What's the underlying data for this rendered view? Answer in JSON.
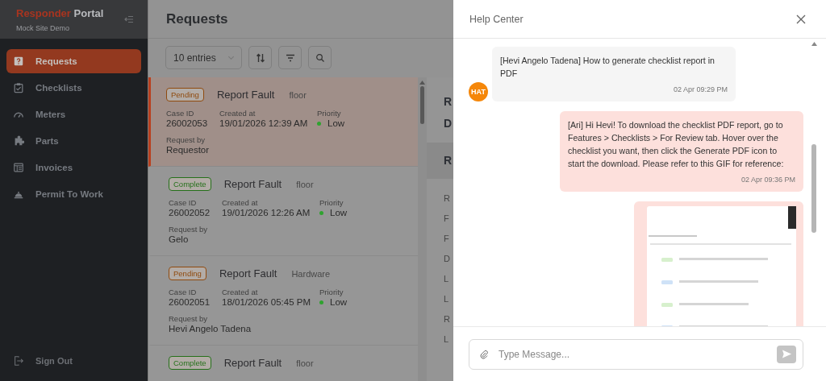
{
  "sidebar": {
    "brand_first": "Responder",
    "brand_second": "Portal",
    "subtitle": "Mock Site Demo",
    "items": [
      {
        "label": "Requests",
        "selected": true
      },
      {
        "label": "Checklists",
        "selected": false
      },
      {
        "label": "Meters",
        "selected": false
      },
      {
        "label": "Parts",
        "selected": false
      },
      {
        "label": "Invoices",
        "selected": false
      },
      {
        "label": "Permit To Work",
        "selected": false
      }
    ],
    "sign_out": "Sign Out"
  },
  "page": {
    "title": "Requests",
    "entries_select": "10 entries"
  },
  "requests": [
    {
      "status": {
        "text": "Pending",
        "color": "#8f4a0e"
      },
      "title": "Report Fault",
      "category": "floor",
      "case_id_label": "Case ID",
      "case_id": "26002053",
      "created_label": "Created at",
      "created": "19/01/2026 12:39 AM",
      "priority_label": "Priority",
      "priority": {
        "text": "Low",
        "color": "#2fa32f"
      },
      "requested_by_label": "Request by",
      "requested_by": "Requestor",
      "selected": true
    },
    {
      "status": {
        "text": "Complete",
        "color": "#25701a"
      },
      "title": "Report Fault",
      "category": "floor",
      "case_id_label": "Case ID",
      "case_id": "26002052",
      "created_label": "Created at",
      "created": "19/01/2026 12:26 AM",
      "priority_label": "Priority",
      "priority": {
        "text": "Low",
        "color": "#2fa32f"
      },
      "requested_by_label": "Request by",
      "requested_by": "Gelo",
      "selected": false
    },
    {
      "status": {
        "text": "Pending",
        "color": "#8f4a0e"
      },
      "title": "Report Fault",
      "category": "Hardware",
      "case_id_label": "Case ID",
      "case_id": "26002051",
      "created_label": "Created at",
      "created": "18/01/2026 05:45 PM",
      "priority_label": "Priority",
      "priority": {
        "text": "Low",
        "color": "#2fa32f"
      },
      "requested_by_label": "Request by",
      "requested_by": "Hevi Angelo Tadena",
      "selected": false
    },
    {
      "status": {
        "text": "Complete",
        "color": "#25701a"
      },
      "title": "Report Fault",
      "category": "floor",
      "selected": false
    }
  ],
  "detail_panel": {
    "heading_lines": [
      "R",
      "D"
    ],
    "section_title": "R",
    "fields": [
      "R",
      "F",
      "F",
      "D",
      "L",
      "L",
      "R",
      "L"
    ]
  },
  "help_center": {
    "title": "Help Center",
    "messages": [
      {
        "kind": "incoming",
        "avatar": "HAT",
        "text": "[Hevi Angelo Tadena] How to generate checklist report in PDF",
        "time": "02 Apr 09:29 PM"
      },
      {
        "kind": "outgoing",
        "text": "[Ari] Hi Hevi! To download the checklist PDF report, go to Features > Checklists > For Review tab. Hover over the checklist you want, then click the Generate PDF icon to start the download. Please refer to this GIF for reference:",
        "time": "02 Apr 09:36 PM"
      },
      {
        "kind": "picture"
      }
    ],
    "composer": {
      "placeholder": "Type Message..."
    }
  }
}
